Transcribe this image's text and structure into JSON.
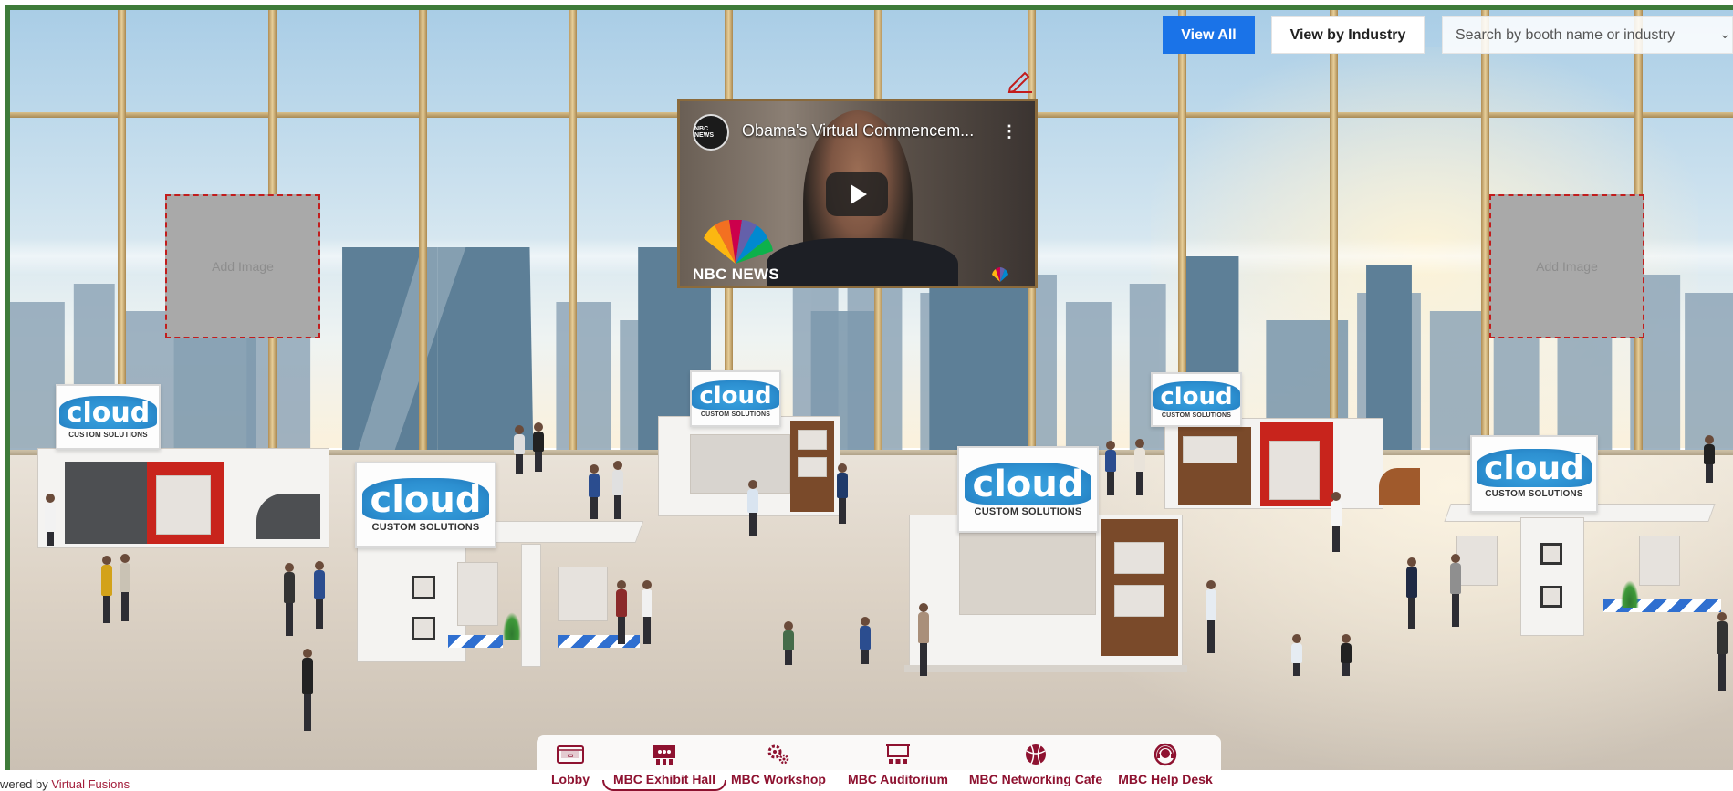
{
  "toolbar": {
    "view_all_label": "View All",
    "view_by_industry_label": "View by Industry",
    "search_placeholder": "Search by booth name or industry"
  },
  "video": {
    "title": "Obama's Virtual Commencem...",
    "channel_badge": "NBC NEWS",
    "watermark_label": "NBC NEWS"
  },
  "image_placeholders": [
    {
      "label": "Add Image"
    },
    {
      "label": "Add Image"
    }
  ],
  "booths": [
    {
      "brand": "cloud",
      "tagline": "CUSTOM SOLUTIONS"
    },
    {
      "brand": "cloud",
      "tagline": "CUSTOM SOLUTIONS"
    },
    {
      "brand": "cloud",
      "tagline": "CUSTOM SOLUTIONS"
    },
    {
      "brand": "cloud",
      "tagline": "CUSTOM SOLUTIONS"
    },
    {
      "brand": "cloud",
      "tagline": "CUSTOM SOLUTIONS"
    },
    {
      "brand": "cloud",
      "tagline": "CUSTOM SOLUTIONS"
    }
  ],
  "nav": {
    "items": [
      {
        "label": "Lobby",
        "icon": "lobby-icon",
        "active": false
      },
      {
        "label": "MBC Exhibit Hall",
        "icon": "exhibit-hall-icon",
        "active": true
      },
      {
        "label": "MBC Workshop",
        "icon": "workshop-gears-icon",
        "active": false
      },
      {
        "label": "MBC Auditorium",
        "icon": "auditorium-icon",
        "active": false
      },
      {
        "label": "MBC Networking Cafe",
        "icon": "networking-ball-icon",
        "active": false
      },
      {
        "label": "MBC Help Desk",
        "icon": "help-desk-icon",
        "active": false
      }
    ],
    "accent_color": "#8e1230"
  },
  "footer": {
    "powered_prefix": "wered by",
    "powered_link": "Virtual Fusions"
  },
  "colors": {
    "primary_button": "#1a73e8",
    "frame_border": "#3e7b3a"
  }
}
